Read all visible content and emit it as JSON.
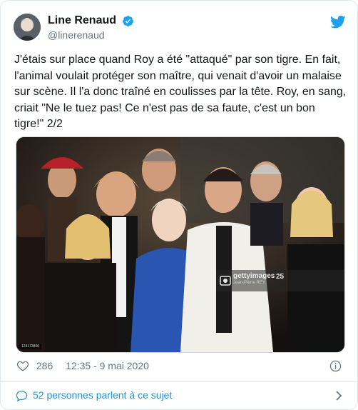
{
  "author": {
    "display_name": "Line Renaud",
    "handle": "@linerenaud",
    "verified": true,
    "avatar_icon": "profile-avatar"
  },
  "tweet": {
    "text": "J'étais sur place quand Roy a été \"attaqué\" par son tigre. En fait, l'animal voulait protéger son maître, qui venait d'avoir un malaise sur scène. Il l'a donc traîné en coulisses par la tête. Roy, en sang, criait \"Ne le tuez pas! Ce n'est pas de sa faute, c'est un bon tigre!\" 2/2"
  },
  "media": {
    "watermark_brand": "gettyimages",
    "watermark_credit": "Jean-Pierre REY",
    "watermark_years": "25",
    "photo_id": "124173806"
  },
  "meta": {
    "likes": "286",
    "timestamp": "12:35 - 9 mai 2020"
  },
  "footer": {
    "conversation": "52 personnes parlent à ce sujet"
  },
  "colors": {
    "brand_blue": "#1da1f2",
    "link_blue": "#1b95e0",
    "muted_gray": "#657786"
  },
  "icons": [
    "twitter-bird-icon",
    "verified-badge-icon",
    "heart-icon",
    "info-icon",
    "speech-bubble-icon",
    "chevron-right-icon"
  ]
}
